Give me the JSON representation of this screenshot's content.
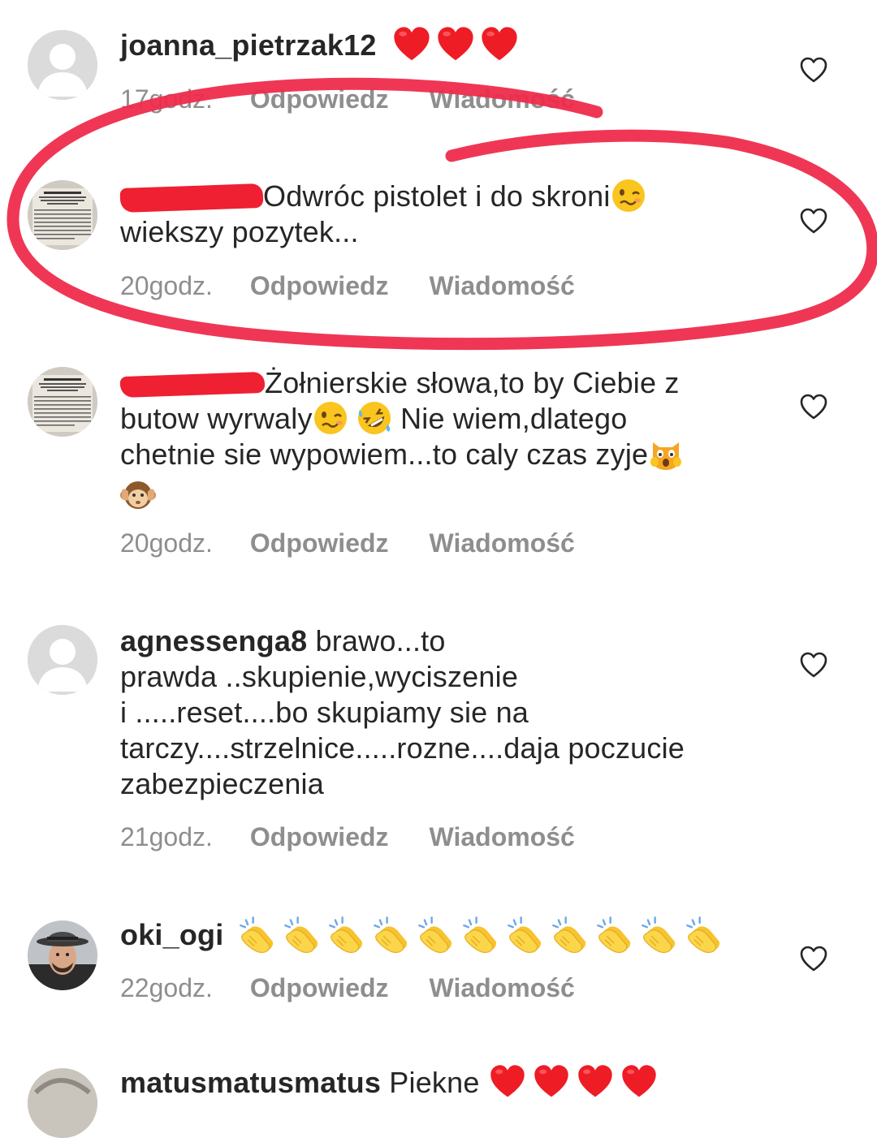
{
  "comments": [
    {
      "username": "joanna_pietrzak12",
      "text": "",
      "emoji": "heart",
      "emoji_count": 3,
      "time": "17godz.",
      "reply_label": "Odpowiedz",
      "message_label": "Wiadomość"
    },
    {
      "username": "",
      "text": "Odwróc pistolet i do skroni",
      "text_line2": "wiekszy pozytek...",
      "emoji": "woozy-face",
      "time": "20godz.",
      "reply_label": "Odpowiedz",
      "message_label": "Wiadomość"
    },
    {
      "username": "",
      "text_line1": "Żołnierskie słowa,to by Ciebie z",
      "text_line2a": "butow wyrwaly",
      "text_line2b": "Nie wiem,dlatego",
      "text_line3": "chetnie sie wypowiem...to caly czas zyje",
      "emojis": [
        "woozy-face",
        "rofl-face",
        "weary-cat-face",
        "hear-no-evil-monkey"
      ],
      "time": "20godz.",
      "reply_label": "Odpowiedz",
      "message_label": "Wiadomość"
    },
    {
      "username": "agnessenga8",
      "text_line1": "brawo...to",
      "text_line2": "prawda ..skupienie,wyciszenie",
      "text_line3": "i .....reset....bo skupiamy sie na",
      "text_line4": "tarczy....strzelnice.....rozne....daja poczucie",
      "text_line5": "zabezpieczenia",
      "time": "21godz.",
      "reply_label": "Odpowiedz",
      "message_label": "Wiadomość"
    },
    {
      "username": "oki_ogi",
      "emoji": "clapping-hands",
      "emoji_count": 11,
      "time": "22godz.",
      "reply_label": "Odpowiedz",
      "message_label": "Wiadomość"
    },
    {
      "username": "matusmatusmatus",
      "text": "Piekne",
      "emoji": "heart",
      "emoji_count": 4
    }
  ],
  "icons": {
    "like": "heart-outline-icon",
    "avatar_default": "default-avatar-icon"
  },
  "colors": {
    "annotation": "#ee2c4c",
    "redaction": "#ee2032",
    "heart_emoji": "#ee1c25",
    "meta_text": "#8e8e8e"
  }
}
